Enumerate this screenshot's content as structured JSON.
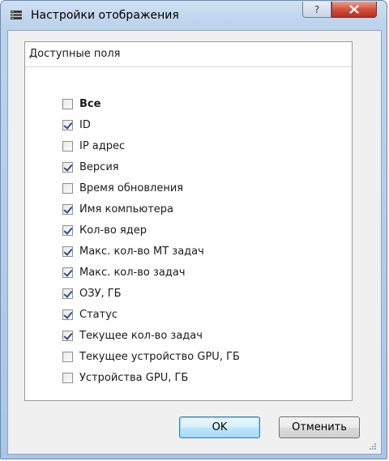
{
  "window": {
    "title": "Настройки отображения",
    "help_glyph": "?",
    "close_glyph": "✕"
  },
  "group": {
    "title": "Доступные поля",
    "items": [
      {
        "label": "Все",
        "checked": false,
        "bold": true
      },
      {
        "label": "ID",
        "checked": true,
        "bold": false
      },
      {
        "label": "IP адрес",
        "checked": false,
        "bold": false
      },
      {
        "label": "Версия",
        "checked": true,
        "bold": false
      },
      {
        "label": "Время обновления",
        "checked": false,
        "bold": false
      },
      {
        "label": "Имя компьютера",
        "checked": true,
        "bold": false
      },
      {
        "label": "Кол-во ядер",
        "checked": true,
        "bold": false
      },
      {
        "label": "Макс. кол-во МТ задач",
        "checked": true,
        "bold": false
      },
      {
        "label": "Макс. кол-во задач",
        "checked": true,
        "bold": false
      },
      {
        "label": "ОЗУ, ГБ",
        "checked": true,
        "bold": false
      },
      {
        "label": "Статус",
        "checked": true,
        "bold": false
      },
      {
        "label": "Текущее кол-во задач",
        "checked": true,
        "bold": false
      },
      {
        "label": "Текущее устройство GPU, ГБ",
        "checked": false,
        "bold": false
      },
      {
        "label": "Устройства GPU, ГБ",
        "checked": false,
        "bold": false
      }
    ]
  },
  "buttons": {
    "ok_label": "OK",
    "cancel_label": "Отменить"
  },
  "colors": {
    "checkmark": "#2b4f8a",
    "close_button": "#c8412f",
    "titlebar": "#bcd3ec"
  }
}
